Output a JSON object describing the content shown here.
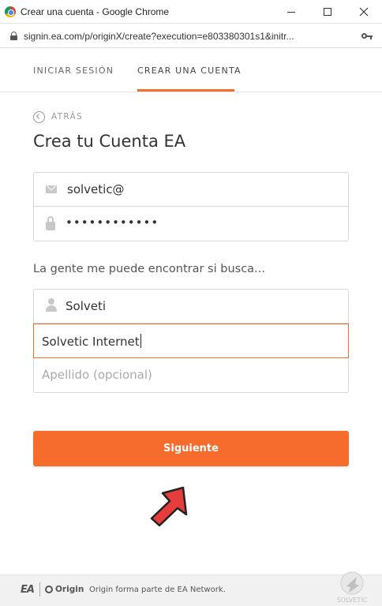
{
  "window": {
    "title": "Crear una cuenta - Google Chrome"
  },
  "browser": {
    "url": "signin.ea.com/p/originX/create?execution=e803380301s1&initr..."
  },
  "tabs": {
    "login": "INICIAR SESIÓN",
    "create": "CREAR UNA CUENTA",
    "active": "create"
  },
  "form": {
    "back_label": "ATRÁS",
    "title": "Crea tu Cuenta EA",
    "email_value": "solvetic@",
    "password_mask": "••••••••••••",
    "helper_text": "La gente me puede encontrar si busca...",
    "first_name_value": "Solveti",
    "nickname_value": "Solvetic Internet",
    "last_name_placeholder": "Apellido (opcional)",
    "submit_label": "Siguiente"
  },
  "footer": {
    "ea_logo": "EA",
    "origin_logo": "Origin",
    "text": "Origin forma parte de EA Network."
  },
  "watermark": {
    "text": "SOLVETIC"
  },
  "colors": {
    "accent": "#f56c2d",
    "annotation_arrow": "#e63c3c"
  },
  "icons": {
    "email": "mail-icon",
    "password": "padlock-icon",
    "name": "user-icon",
    "back": "chevron-left-circle-icon"
  }
}
